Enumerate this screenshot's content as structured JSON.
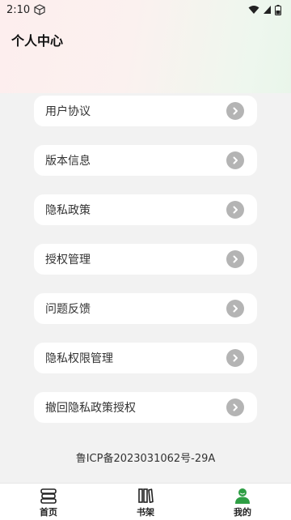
{
  "status_bar": {
    "time": "2:10"
  },
  "header": {
    "title": "个人中心"
  },
  "menu": {
    "items": [
      {
        "label": "用户协议",
        "icon": "chevron-right-icon"
      },
      {
        "label": "版本信息",
        "icon": "chevron-right-icon"
      },
      {
        "label": "隐私政策",
        "icon": "chevron-right-icon"
      },
      {
        "label": "授权管理",
        "icon": "chevron-right-icon"
      },
      {
        "label": "问题反馈",
        "icon": "chevron-right-icon"
      },
      {
        "label": "隐私权限管理",
        "icon": "chevron-right-icon"
      },
      {
        "label": "撤回隐私政策授权",
        "icon": "chevron-right-icon"
      }
    ]
  },
  "footer": {
    "icp": "鲁ICP备2023031062号-29A"
  },
  "bottom_nav": {
    "items": [
      {
        "label": "首页",
        "icon": "stacked-books-icon",
        "active": false
      },
      {
        "label": "书架",
        "icon": "bookshelf-icon",
        "active": false
      },
      {
        "label": "我的",
        "icon": "user-profile-icon",
        "active": true
      }
    ]
  },
  "colors": {
    "active_tab": "#2e9e44",
    "arrow_bg": "#b4b4b4",
    "page_bg": "#f2f2f2"
  }
}
